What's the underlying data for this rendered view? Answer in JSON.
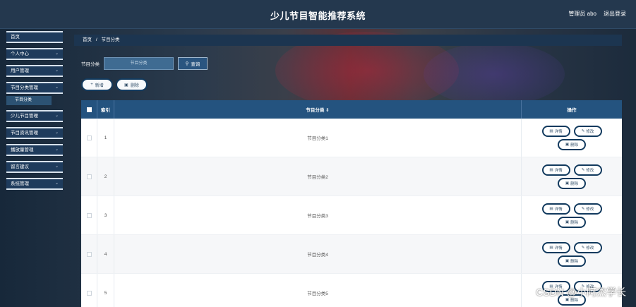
{
  "header": {
    "title": "少儿节目智能推荐系统",
    "admin_label": "管理员 abo",
    "logout_label": "退出登录"
  },
  "sidebar": {
    "items": [
      {
        "label": "首页",
        "chevron": ""
      },
      {
        "label": "个人中心",
        "chevron": "⌄"
      },
      {
        "label": "用户管理",
        "chevron": "⌄"
      },
      {
        "label": "节目分类管理",
        "chevron": "⌄"
      },
      {
        "label": "少儿节目管理",
        "chevron": "⌄"
      },
      {
        "label": "节目资讯管理",
        "chevron": "⌄"
      },
      {
        "label": "播放量管理",
        "chevron": "⌄"
      },
      {
        "label": "留言建议",
        "chevron": "⌄"
      },
      {
        "label": "系统管理",
        "chevron": "⌄"
      }
    ],
    "sub_item": "节目分类"
  },
  "breadcrumb": {
    "home": "首页",
    "sep": "/",
    "current": "节目分类"
  },
  "search": {
    "label": "节目分类",
    "placeholder": "节目分类",
    "button": "查询"
  },
  "actions": {
    "add": "新增",
    "delete": "删除"
  },
  "table": {
    "headers": {
      "index": "索引",
      "name": "节目分类 ⇕",
      "ops": "操作"
    },
    "rows": [
      {
        "index": "1",
        "name": "节目分类1"
      },
      {
        "index": "2",
        "name": "节目分类2"
      },
      {
        "index": "3",
        "name": "节目分类3"
      },
      {
        "index": "4",
        "name": "节目分类4"
      },
      {
        "index": "5",
        "name": "节目分类5"
      }
    ],
    "op_labels": {
      "detail": "详情",
      "edit": "修改",
      "delete": "删除"
    }
  },
  "watermark": "CSDN @小阿杰学长",
  "colors": {
    "topbar": "#24384e",
    "table_header": "#24537f",
    "pill_border": "#123a5e"
  }
}
